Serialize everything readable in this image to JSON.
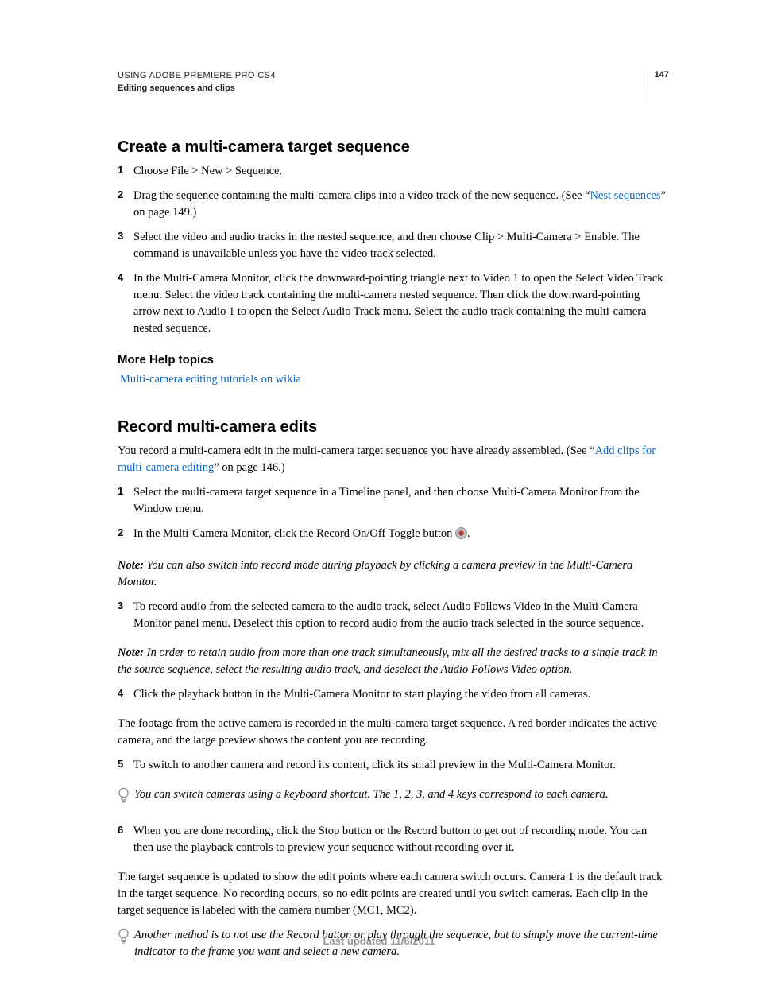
{
  "header": {
    "doc_title": "USING ADOBE PREMIERE PRO CS4",
    "doc_section": "Editing sequences and clips",
    "page_number": "147"
  },
  "section1": {
    "title": "Create a multi-camera target sequence",
    "steps": {
      "s1": "Choose File > New > Sequence.",
      "s2a": "Drag the sequence containing the multi-camera clips into a video track of the new sequence. (See “",
      "s2_link": "Nest sequences",
      "s2b": "” on page 149.)",
      "s3": "Select the video and audio tracks in the nested sequence, and then choose Clip > Multi-Camera > Enable. The command is unavailable unless you have the video track selected.",
      "s4": "In the Multi-Camera Monitor, click the downward-pointing triangle next to Video 1 to open the Select Video Track menu. Select the video track containing the multi-camera nested sequence. Then click the downward-pointing arrow next to Audio 1 to open the Select Audio Track menu. Select the audio track containing the multi-camera nested sequence."
    },
    "more_help_title": "More Help topics",
    "more_help_link": "Multi-camera editing tutorials on wikia"
  },
  "section2": {
    "title": "Record multi-camera edits",
    "intro_a": "You record a multi-camera edit in the multi-camera target sequence you have already assembled. (See “",
    "intro_link": "Add clips for multi-camera editing",
    "intro_b": "” on page 146.)",
    "steps": {
      "s1": "Select the multi-camera target sequence in a Timeline panel, and then choose Multi-Camera Monitor from the Window menu.",
      "s2a": "In the Multi-Camera Monitor, click the Record On/Off Toggle button ",
      "s2b": ".",
      "s3": "To record audio from the selected camera to the audio track, select Audio Follows Video in the Multi-Camera Monitor panel menu. Deselect this option to record audio from the audio track selected in the source sequence.",
      "s4": "Click the playback button in the Multi-Camera Monitor to start playing the video from all cameras.",
      "s5": "To switch to another camera and record its content, click its small preview in the Multi-Camera Monitor.",
      "s6": "When you are done recording, click the Stop button or the Record button to get out of recording mode. You can then use the playback controls to preview your sequence without recording over it."
    },
    "note1_label": "Note: ",
    "note1_body": "You can also switch into record mode during playback by clicking a camera preview in the Multi-Camera Monitor.",
    "note2_label": "Note: ",
    "note2_body": "In order to retain audio from more than one track simultaneously, mix all the desired tracks to a single track in the source sequence, select the resulting audio track, and deselect the Audio Follows Video option.",
    "para_after4": "The footage from the active camera is recorded in the multi-camera target sequence. A red border indicates the active camera, and the large preview shows the content you are recording.",
    "tip1": "You can switch cameras using a keyboard shortcut. The 1, 2, 3, and 4 keys correspond to each camera.",
    "para_after6": "The target sequence is updated to show the edit points where each camera switch occurs. Camera 1 is the default track in the target sequence. No recording occurs, so no edit points are created until you switch cameras. Each clip in the target sequence is labeled with the camera number (MC1, MC2).",
    "tip2": "Another method is to not use the Record button or play through the sequence, but to simply move the current-time indicator to the frame you want and select a new camera."
  },
  "footer": {
    "last_updated": "Last updated 11/6/2011"
  }
}
